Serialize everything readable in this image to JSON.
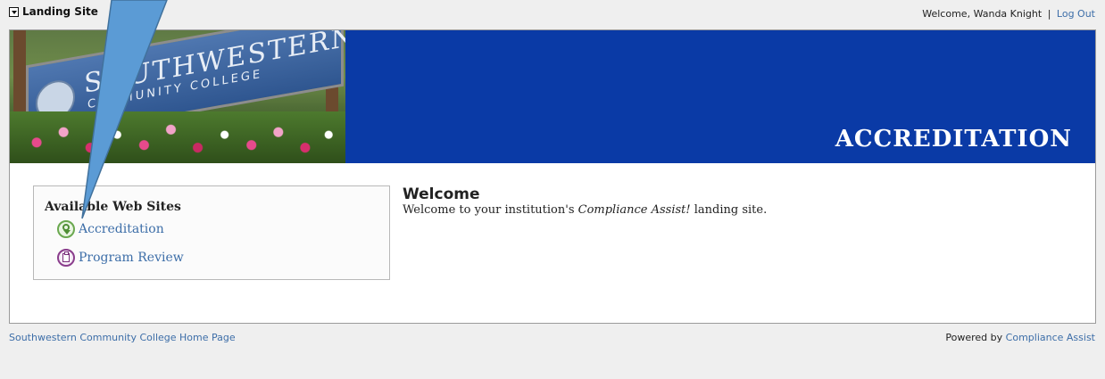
{
  "topbar": {
    "site_menu_label": "Landing Site",
    "welcome_prefix": "Welcome, ",
    "user_name": "Wanda Knight",
    "separator": "|",
    "logout_label": "Log Out"
  },
  "banner": {
    "sign_line1": "SOUTHWESTERN",
    "sign_line2": "COMMUNITY COLLEGE",
    "title": "ACCREDITATION"
  },
  "sites": {
    "heading": "Available Web Sites",
    "items": [
      {
        "label": "Accreditation",
        "icon": "accreditation-ribbon-icon",
        "color": "#6aa84f"
      },
      {
        "label": "Program Review",
        "icon": "clipboard-icon",
        "color": "#8a3d8c"
      }
    ]
  },
  "welcome": {
    "title": "Welcome",
    "text_before": "Welcome to your institution's ",
    "text_em": "Compliance Assist!",
    "text_after": " landing site."
  },
  "footer": {
    "home_link": "Southwestern Community College Home Page",
    "powered_prefix": "Powered by ",
    "powered_link": "Compliance Assist"
  },
  "colors": {
    "banner_blue": "#0a3aa6",
    "link_blue": "#3d6ea8",
    "callout_fill": "#5b9bd5"
  }
}
